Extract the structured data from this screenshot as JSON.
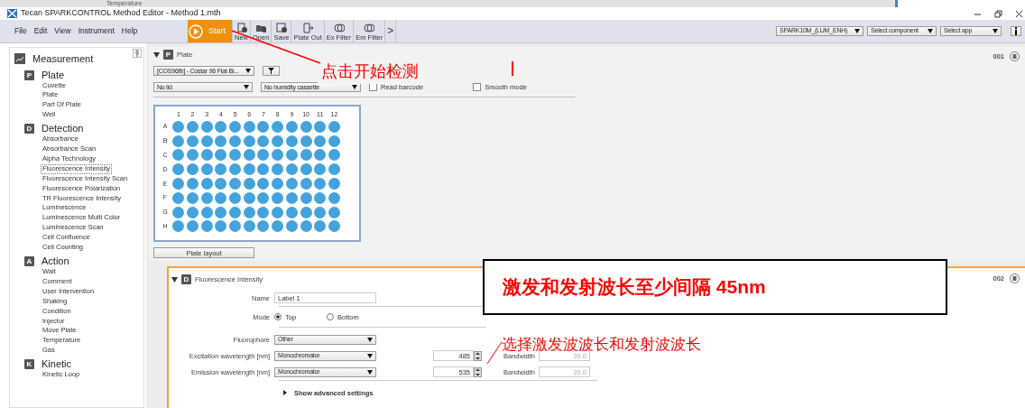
{
  "background_window": {
    "text": "Temperature"
  },
  "window": {
    "title": "Tecan SPARKCONTROL Method Editor - Method 1.mth"
  },
  "menu": [
    "File",
    "Edit",
    "View",
    "Instrument",
    "Help"
  ],
  "toolbar": [
    {
      "label": "Start",
      "kind": "start"
    },
    {
      "label": "New",
      "kind": "new"
    },
    {
      "label": "Open",
      "kind": "open"
    },
    {
      "label": "Save",
      "kind": "save"
    },
    {
      "label": "Plate Out",
      "kind": "plateout"
    },
    {
      "label": "Ex Filter",
      "kind": "filter"
    },
    {
      "label": "Em Filter",
      "kind": "filter"
    },
    {
      "label": ">",
      "kind": "more"
    }
  ],
  "selectors": [
    "SPARK10M_(LUM_ENH)",
    "Select component",
    "Select app"
  ],
  "sidebar": {
    "title": "Measurement",
    "groups": [
      {
        "letter": "P",
        "title": "Plate",
        "items": [
          {
            "label": "Cuvette",
            "selected": false
          },
          {
            "label": "Plate",
            "selected": false
          },
          {
            "label": "Part Of Plate",
            "selected": false
          },
          {
            "label": "Well",
            "selected": false
          }
        ]
      },
      {
        "letter": "D",
        "title": "Detection",
        "items": [
          {
            "label": "Absorbance",
            "selected": false
          },
          {
            "label": "Absorbance Scan",
            "selected": false
          },
          {
            "label": "Alpha Technology",
            "selected": false
          },
          {
            "label": "Fluorescence Intensity",
            "selected": true
          },
          {
            "label": "Fluorescence Intensity Scan",
            "selected": false
          },
          {
            "label": "Fluorescence Polarization",
            "selected": false
          },
          {
            "label": "TR Fluorescence Intensity",
            "selected": false
          },
          {
            "label": "Luminescence",
            "selected": false
          },
          {
            "label": "Luminescence Multi Color",
            "selected": false
          },
          {
            "label": "Luminescence Scan",
            "selected": false
          },
          {
            "label": "Cell Confluence",
            "selected": false
          },
          {
            "label": "Cell Counting",
            "selected": false
          }
        ]
      },
      {
        "letter": "A",
        "title": "Action",
        "items": [
          {
            "label": "Wait",
            "selected": false
          },
          {
            "label": "Comment",
            "selected": false
          },
          {
            "label": "User Intervention",
            "selected": false
          },
          {
            "label": "Shaking",
            "selected": false
          },
          {
            "label": "Condition",
            "selected": false
          },
          {
            "label": "Injector",
            "selected": false
          },
          {
            "label": "Move Plate",
            "selected": false
          },
          {
            "label": "Temperature",
            "selected": false
          },
          {
            "label": "Gas",
            "selected": false
          }
        ]
      },
      {
        "letter": "K",
        "title": "Kinetic",
        "items": [
          {
            "label": "Kinetic Loop",
            "selected": false
          }
        ]
      }
    ]
  },
  "plate_section": {
    "letter": "P",
    "title": "Plate",
    "number": "001",
    "expanded": true,
    "plate_type": "[COS96fb] - Costar 96 Flat Bl...",
    "lid": "No lid",
    "humidity": "No humidity cassette",
    "checkboxes": [
      {
        "label": "Read barcode",
        "checked": false
      },
      {
        "label": "Smooth mode",
        "checked": false
      }
    ],
    "columns": [
      "1",
      "2",
      "3",
      "4",
      "5",
      "6",
      "7",
      "8",
      "9",
      "10",
      "11",
      "12"
    ],
    "rows": [
      "A",
      "B",
      "C",
      "D",
      "E",
      "F",
      "G",
      "H"
    ],
    "button": "Plate layout"
  },
  "detection_section": {
    "letter": "D",
    "title": "Fluorescence Intensity",
    "number": "002",
    "expanded": true,
    "name_label": "Name",
    "name_value": "Label 1",
    "mode_label": "Mode",
    "modes": [
      {
        "label": "Top",
        "selected": true
      },
      {
        "label": "Bottom",
        "selected": false
      }
    ],
    "fluorophore_label": "Fluorophore",
    "fluorophore": "Other",
    "wavelengths": [
      {
        "label": "Excitation wavelength [nm]",
        "source": "Monochromator",
        "value": "485",
        "bandwidth_label": "Bandwidth",
        "bandwidth": "20.0"
      },
      {
        "label": "Emission wavelength [nm]",
        "source": "Monochromator",
        "value": "535",
        "bandwidth_label": "Bandwidth",
        "bandwidth": "20.0"
      }
    ],
    "advanced": "Show advanced settings"
  },
  "annotations": [
    {
      "kind": "callout",
      "text": "点击开始检测"
    },
    {
      "kind": "boxed",
      "text": "激发和发射波长至少间隔 45nm"
    },
    {
      "kind": "callout2",
      "text": "选择激发波波长和发射波波长"
    }
  ]
}
